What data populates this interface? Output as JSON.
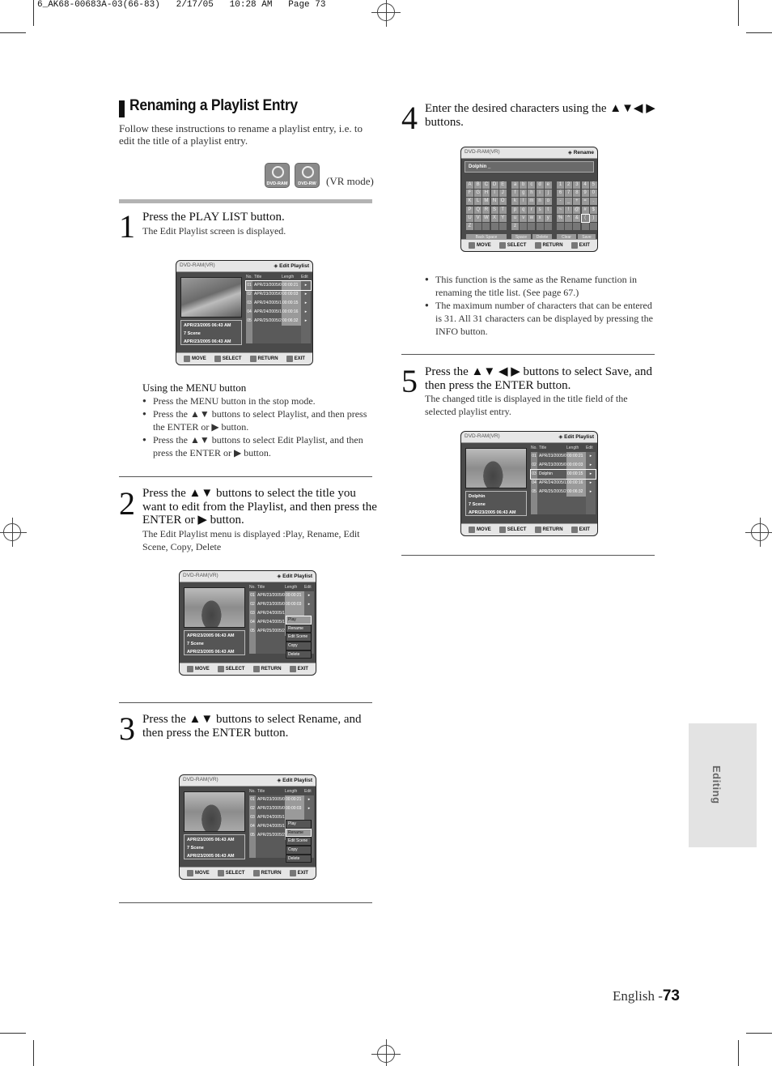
{
  "print_slug": "6_AK68-00683A-03(66-83)   2/17/05   10:28 AM   Page 73",
  "section": {
    "title": "Renaming a Playlist Entry",
    "intro": "Follow these instructions to rename a playlist entry, i.e. to edit the title of a playlist entry.",
    "disc_icons": [
      {
        "icon": "dvd-ram-disc-icon",
        "label": "DVD-RAM"
      },
      {
        "icon": "dvd-rw-disc-icon",
        "label": "DVD-RW"
      }
    ],
    "mode_note": "(VR mode)"
  },
  "steps": [
    {
      "number": "1",
      "heading": "Press the PLAY LIST button.",
      "sub": "The Edit Playlist screen is displayed.",
      "menu_note": {
        "title": "Using the MENU button",
        "bullets": [
          "Press the MENU button in the stop mode.",
          "Press the ▲▼ buttons to select Playlist, and then press the ENTER or ▶ button.",
          "Press the ▲▼ buttons to select Edit Playlist, and then press the ENTER or ▶ button."
        ]
      }
    },
    {
      "number": "2",
      "heading": "Press the ▲▼ buttons to select the title you want to edit from the Playlist, and then press the ENTER or ▶ button.",
      "sub": "The Edit Playlist menu is displayed :Play, Rename, Edit Scene, Copy, Delete"
    },
    {
      "number": "3",
      "heading": "Press the ▲▼ buttons to select Rename, and then press the ENTER button."
    },
    {
      "number": "4",
      "heading": "Enter the desired characters using the ▲▼◀ ▶ buttons.",
      "bullets": [
        "This function is the same as the Rename function in renaming the title list. (See page 67.)",
        "The maximum number of characters that can be entered is 31. All 31 characters can be displayed by pressing the INFO button."
      ]
    },
    {
      "number": "5",
      "heading": "Press the ▲▼ ◀ ▶ buttons to select Save, and then press the ENTER button.",
      "sub": "The changed title is displayed in the title field of the selected playlist entry."
    }
  ],
  "osd": {
    "source": "DVD-RAM(VR)",
    "mode_edit": "◈ Edit Playlist",
    "mode_rename": "◈ Rename",
    "columns": {
      "no": "No.",
      "title": "Title",
      "length": "Length",
      "edit": "Edit"
    },
    "footer": {
      "move": "MOVE",
      "select": "SELECT",
      "return": "RETURN",
      "exit": "EXIT"
    },
    "info": {
      "date": "APR/23/2005 06:43 AM",
      "scenes": "7 Scene",
      "time": "APR/23/2005 06:43 AM",
      "renamed": "Dolphin"
    },
    "rows": [
      {
        "no": "01",
        "title": "APR/23/2005/0",
        "length": "00:00:21",
        "edit": "▸"
      },
      {
        "no": "02",
        "title": "APR/23/2005/0",
        "length": "00:00:03",
        "edit": "▸"
      },
      {
        "no": "03",
        "title": "APR/24/2005/1",
        "length": "00:00:15",
        "edit": "▸"
      },
      {
        "no": "04",
        "title": "APR/24/2005/1",
        "length": "00:00:16",
        "edit": "▸"
      },
      {
        "no": "05",
        "title": "APR/25/2005/2",
        "length": "00:06:32",
        "edit": "▸"
      }
    ],
    "renamed_title": "Dolphin",
    "popup_menu": [
      "Play",
      "Rename",
      "Edit Scene",
      "Copy",
      "Delete"
    ],
    "rename_field": "Dolphin _",
    "keys_upper": [
      "A",
      "B",
      "C",
      "D",
      "E",
      "F",
      "G",
      "H",
      "I",
      "J",
      "K",
      "L",
      "M",
      "N",
      "O",
      "P",
      "Q",
      "R",
      "S",
      "T",
      "U",
      "V",
      "W",
      "X",
      "Y",
      "Z",
      "",
      "",
      "",
      ""
    ],
    "keys_lower": [
      "a",
      "b",
      "c",
      "d",
      "e",
      "f",
      "g",
      "h",
      "i",
      "j",
      "k",
      "l",
      "m",
      "n",
      "o",
      "p",
      "q",
      "r",
      "s",
      "t",
      "u",
      "v",
      "w",
      "x",
      "y",
      "z",
      "",
      "",
      "",
      ""
    ],
    "keys_symbols": [
      "1",
      "2",
      "3",
      "4",
      "5",
      "6",
      "7",
      "8",
      "9",
      "0",
      "-",
      "_",
      "+",
      "=",
      ".",
      "~",
      "!",
      "@",
      "#",
      "$",
      "%",
      "^",
      "&",
      "(",
      ")",
      "",
      "",
      "",
      "",
      ""
    ],
    "key_buttons": {
      "backspace": "Back Space",
      "space": "Space",
      "delete": "Delete",
      "clear": "Clear",
      "save": "Save"
    }
  },
  "side_tab": "Editing",
  "footer": {
    "lang": "English -",
    "page": "73"
  }
}
